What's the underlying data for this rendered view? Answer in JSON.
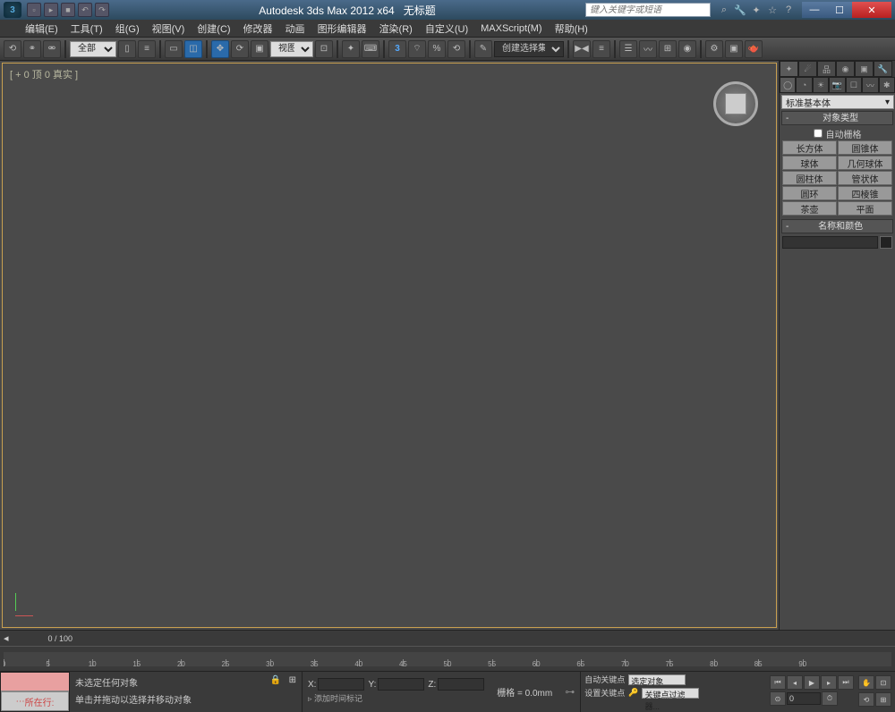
{
  "title": {
    "app": "Autodesk 3ds Max 2012 x64",
    "doc": "无标题",
    "search_placeholder": "键入关键字或短语"
  },
  "menu": [
    "编辑(E)",
    "工具(T)",
    "组(G)",
    "视图(V)",
    "创建(C)",
    "修改器",
    "动画",
    "图形编辑器",
    "渲染(R)",
    "自定义(U)",
    "MAXScript(M)",
    "帮助(H)"
  ],
  "toolbar": {
    "selection_filter": "全部",
    "ref_coord": "视图",
    "angle_snap": "3",
    "named_sets": "创建选择集"
  },
  "viewport": {
    "label": "[ + 0 顶 0 真实 ]"
  },
  "cmd_panel": {
    "category": "标准基本体",
    "rollout_type": "对象类型",
    "auto_grid": "自动栅格",
    "objects": [
      "长方体",
      "圆锥体",
      "球体",
      "几何球体",
      "圆柱体",
      "管状体",
      "圆环",
      "四棱锥",
      "茶壶",
      "平面"
    ],
    "rollout_name": "名称和颜色"
  },
  "timeline": {
    "current": "0 / 100",
    "ticks": [
      0,
      5,
      10,
      15,
      20,
      25,
      30,
      35,
      40,
      45,
      50,
      55,
      60,
      65,
      70,
      75,
      80,
      85,
      90
    ]
  },
  "status": {
    "prompt_btn": "所在行:",
    "msg1": "未选定任何对象",
    "msg2": "单击并拖动以选择并移动对象",
    "coord_x": "X:",
    "coord_y": "Y:",
    "coord_z": "Z:",
    "grid": "栅格 = 0.0mm",
    "add_time_tag": "添加时间标记",
    "auto_key": "自动关键点",
    "set_key": "设置关键点",
    "selected": "选定对象",
    "key_filter": "关键点过滤器...",
    "frame": "0"
  }
}
